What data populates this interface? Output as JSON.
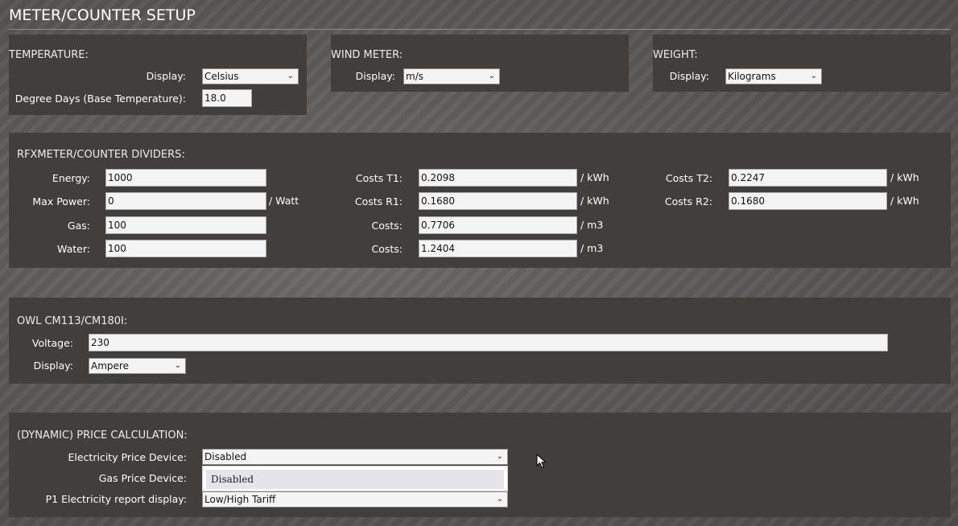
{
  "page": {
    "title": "METER/COUNTER SETUP"
  },
  "temperature": {
    "title": "TEMPERATURE:",
    "display_label": "Display:",
    "display_value": "Celsius",
    "degree_days_label": "Degree Days (Base Temperature):",
    "degree_days_value": "18.0"
  },
  "wind": {
    "title": "WIND METER:",
    "display_label": "Display:",
    "display_value": "m/s"
  },
  "weight": {
    "title": "WEIGHT:",
    "display_label": "Display:",
    "display_value": "Kilograms"
  },
  "rfx": {
    "title": "RFXMETER/COUNTER DIVIDERS:",
    "energy_label": "Energy:",
    "energy_value": "1000",
    "maxpower_label": "Max Power:",
    "maxpower_value": "0",
    "maxpower_unit": "/ Watt",
    "gas_label": "Gas:",
    "gas_value": "100",
    "water_label": "Water:",
    "water_value": "100",
    "costs_t1_label": "Costs T1:",
    "costs_t1_value": "0.2098",
    "costs_t1_unit": "/ kWh",
    "costs_r1_label": "Costs R1:",
    "costs_r1_value": "0.1680",
    "costs_r1_unit": "/ kWh",
    "costs_gas_label": "Costs:",
    "costs_gas_value": "0.7706",
    "costs_gas_unit": "/ m3",
    "costs_water_label": "Costs:",
    "costs_water_value": "1.2404",
    "costs_water_unit": "/ m3",
    "costs_t2_label": "Costs T2:",
    "costs_t2_value": "0.2247",
    "costs_t2_unit": "/ kWh",
    "costs_r2_label": "Costs R2:",
    "costs_r2_value": "0.1680",
    "costs_r2_unit": "/ kWh"
  },
  "owl": {
    "title": "OWL CM113/CM180I:",
    "voltage_label": "Voltage:",
    "voltage_value": "230",
    "display_label": "Display:",
    "display_value": "Ampere"
  },
  "price": {
    "title": "(DYNAMIC) PRICE CALCULATION:",
    "electricity_label": "Electricity Price Device:",
    "electricity_value": "Disabled",
    "gas_label": "Gas Price Device:",
    "p1_label": "P1 Electricity report display:",
    "p1_value": "Low/High Tariff",
    "dropdown_option": "Disabled"
  },
  "icons": {
    "chevron": "chevron-down-icon",
    "cursor": "mouse-pointer-icon"
  }
}
